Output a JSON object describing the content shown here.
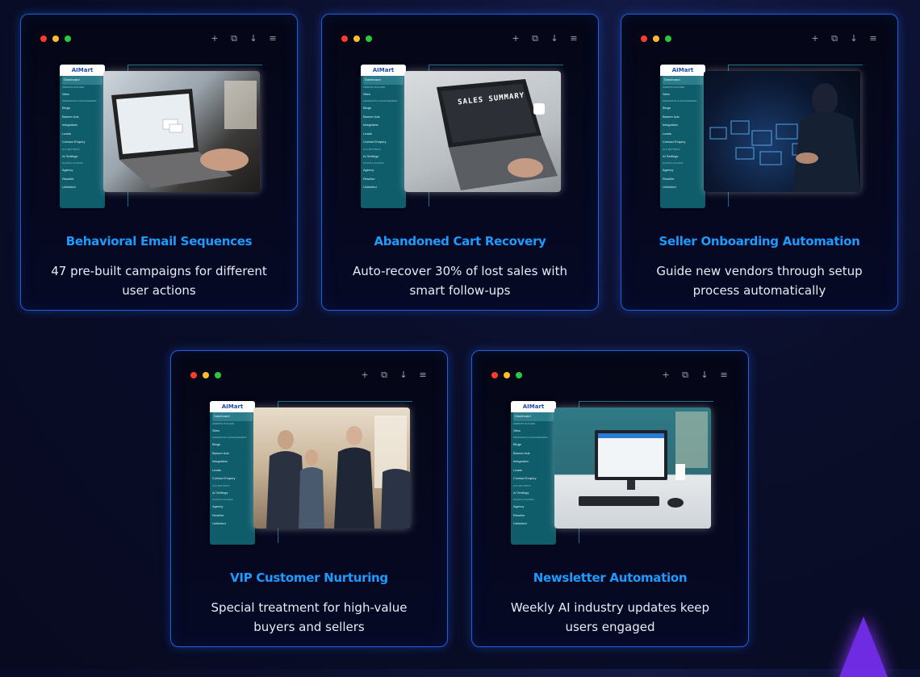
{
  "brand": "AIMart",
  "sidebar_items": [
    "Dashboard",
    "WEBSITE BUILDER",
    "Sites",
    "MARKETING & ENGAGEMENT",
    "Blogs",
    "Banner Ads",
    "Integration",
    "Leads",
    "Contact Enquiry",
    "AI & SETTINGS",
    "AI Settings",
    "PLANS & ACCESS",
    "Agency",
    "Reseller",
    "Unlimited"
  ],
  "window_tools": [
    "+",
    "⧉",
    "↓",
    "≡"
  ],
  "cards": [
    {
      "title": "Behavioral Email Sequences",
      "desc": "47 pre-built campaigns for different user actions"
    },
    {
      "title": "Abandoned Cart Recovery",
      "desc": "Auto-recover 30% of lost sales with smart follow-ups",
      "photo_text": "SALES SUMMARY"
    },
    {
      "title": "Seller Onboarding Automation",
      "desc": "Guide new vendors through setup process automatically"
    },
    {
      "title": "VIP Customer Nurturing",
      "desc": "Special treatment for high-value buyers and sellers"
    },
    {
      "title": "Newsletter Automation",
      "desc": "Weekly AI industry updates keep users engaged"
    }
  ]
}
